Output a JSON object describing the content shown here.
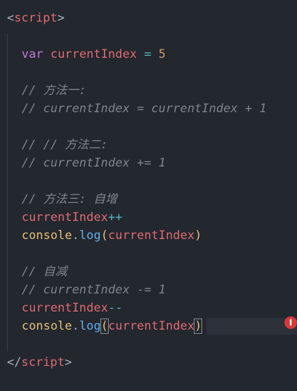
{
  "editor": {
    "tag_open": {
      "lt": "<",
      "name": "script",
      "gt": ">"
    },
    "tag_close": {
      "lt": "</",
      "name": "script",
      "gt": ">"
    },
    "line_var": {
      "kw": "var",
      "name": "currentIndex",
      "op": "=",
      "value": "5"
    },
    "comment_1a": "// 方法一:",
    "comment_1b": "// currentIndex = currentIndex + 1",
    "comment_2a": "// // 方法二:",
    "comment_2b": "// currentIndex += 1",
    "comment_3a": "// 方法三: 自增",
    "increment": {
      "name": "currentIndex",
      "op": "++"
    },
    "log_1": {
      "obj": "console",
      "dot": ".",
      "fn": "log",
      "open": "(",
      "arg": "currentIndex",
      "close": ")"
    },
    "comment_4a": "// 自减",
    "comment_4b": "// currentIndex -= 1",
    "decrement": {
      "name": "currentIndex",
      "op": "--"
    },
    "log_2": {
      "obj": "console",
      "dot": ".",
      "fn": "log",
      "open": "(",
      "arg": "currentIndex",
      "close": ")"
    }
  },
  "indicator": {
    "glyph": "I",
    "color": "#d73a3a"
  }
}
